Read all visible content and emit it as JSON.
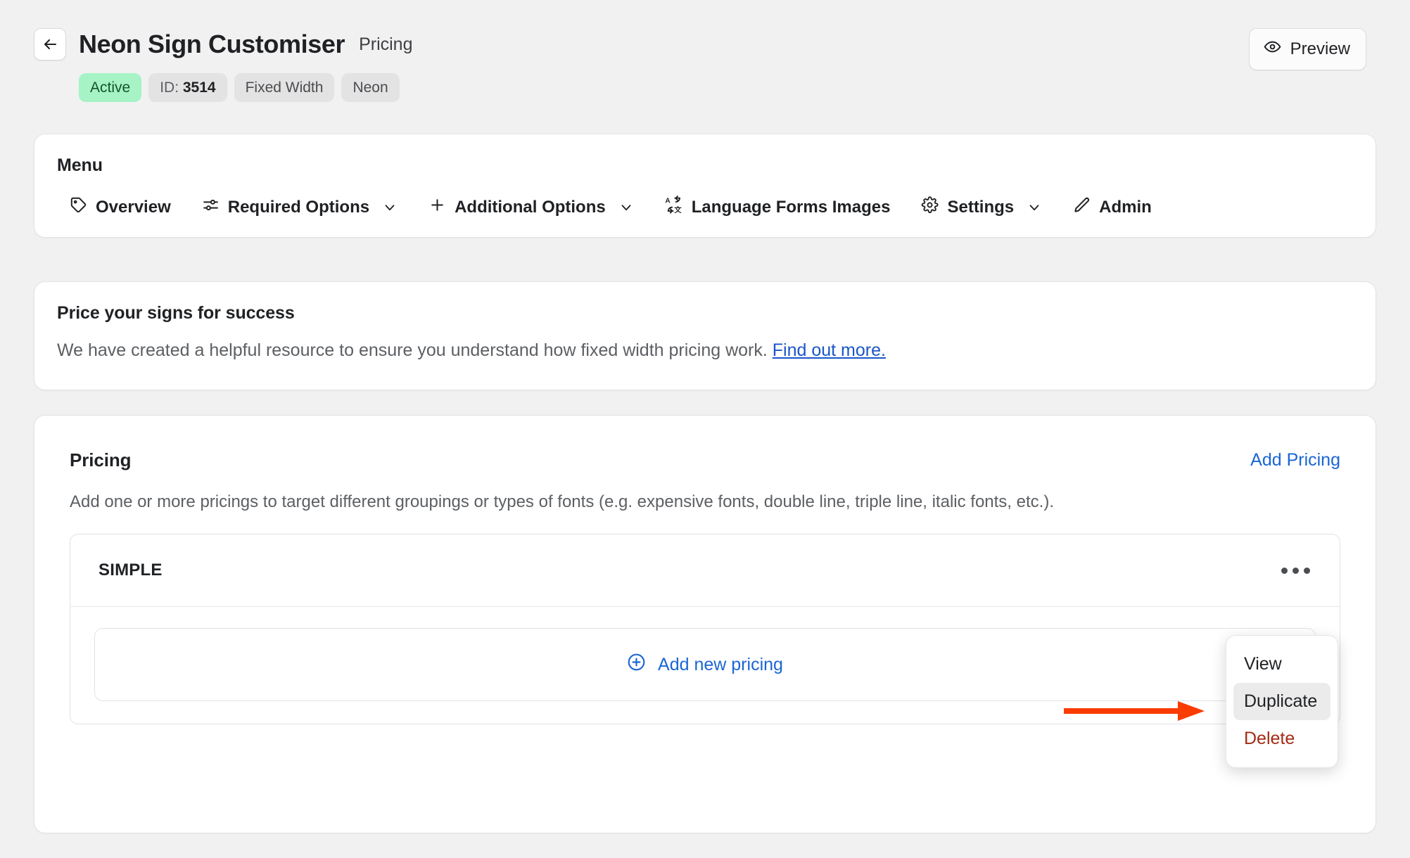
{
  "header": {
    "back_icon": "arrow-left-icon",
    "title": "Neon Sign Customiser",
    "subtitle": "Pricing",
    "badges": [
      {
        "label": "Active",
        "type": "active"
      },
      {
        "label_prefix": "ID: ",
        "label_value": "3514",
        "type": "id"
      },
      {
        "label": "Fixed Width",
        "type": "plain"
      },
      {
        "label": "Neon",
        "type": "plain"
      }
    ],
    "preview_button": {
      "label": "Preview",
      "icon": "eye-icon"
    }
  },
  "menu_card": {
    "heading": "Menu",
    "items": [
      {
        "label": "Overview",
        "icon": "tag-icon",
        "caret": false
      },
      {
        "label": "Required Options",
        "icon": "sliders-icon",
        "caret": true
      },
      {
        "label": "Additional Options",
        "icon": "plus-icon",
        "caret": true
      },
      {
        "label": "Language Forms Images",
        "icon": "translate-icon",
        "caret": false
      },
      {
        "label": "Settings",
        "icon": "gear-icon",
        "caret": true
      },
      {
        "label": "Admin",
        "icon": "pencil-icon",
        "caret": false
      }
    ]
  },
  "resource_card": {
    "heading": "Price your signs for success",
    "body": "We have created a helpful resource to ensure you understand how fixed width pricing work.",
    "link": "Find out more."
  },
  "pricing_card": {
    "heading": "Pricing",
    "add_pricing_label": "Add Pricing",
    "description": "Add one or more pricings to target different groupings or types of fonts (e.g. expensive fonts, double line, triple line, italic fonts, etc.).",
    "group": {
      "title": "SIMPLE",
      "kebab_icon": "more-horizontal-icon",
      "add_new_pricing_label": "Add new pricing",
      "add_new_pricing_icon": "plus-circle-icon"
    }
  },
  "dropdown": {
    "items": [
      {
        "label": "View",
        "state": "normal"
      },
      {
        "label": "Duplicate",
        "state": "highlighted"
      },
      {
        "label": "Delete",
        "state": "danger"
      }
    ]
  },
  "annotation": {
    "type": "arrow-right",
    "color": "#fa3c00"
  },
  "colors": {
    "page_background": "#f1f1f1",
    "card_background": "#ffffff",
    "link_blue": "#1a66d4",
    "active_badge": "#a6f3c5",
    "danger_red": "#a32b14",
    "annotation_red": "#fa3c00"
  }
}
